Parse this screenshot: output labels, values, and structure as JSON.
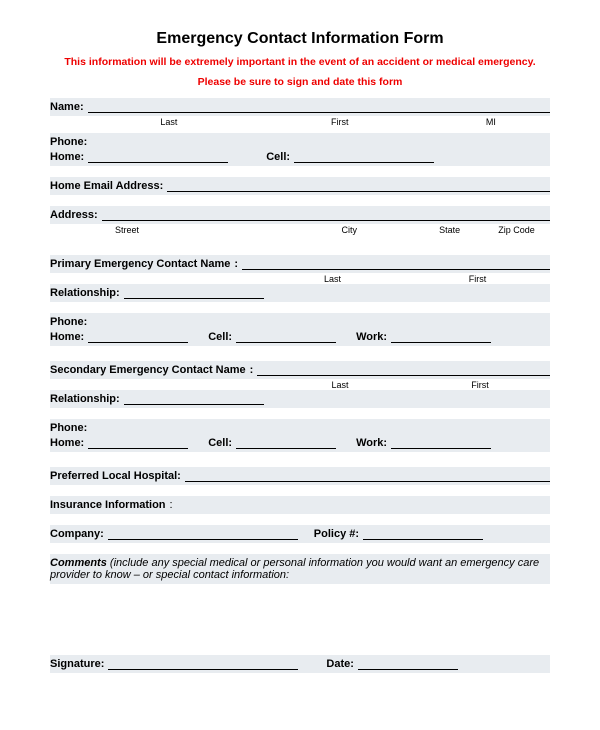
{
  "title": "Emergency Contact Information Form",
  "warning": "This information will be extremely important in the event of an accident or medical emergency.",
  "signprompt": "Please be sure to sign and date this form",
  "name_label": "Name:",
  "sub_last": "Last",
  "sub_first": "First",
  "sub_mi": "MI",
  "phone_label": "Phone:",
  "home_label": "Home:",
  "cell_label": "Cell:",
  "email_label": "Home Email Address:",
  "address_label": "Address:",
  "sub_street": "Street",
  "sub_city": "City",
  "sub_state": "State",
  "sub_zip": "Zip Code",
  "primary_label": "Primary Emergency Contact Name",
  "secondary_label": "Secondary Emergency Contact Name",
  "relationship_label": "Relationship:",
  "work_label": "Work:",
  "hospital_label": "Preferred Local Hospital:",
  "insurance_label": "Insurance Information",
  "company_label": "Company:",
  "policy_label": "Policy #:",
  "comments_label": "Comments",
  "comments_text": " (include any special medical or personal information you would want an emergency care provider to know – or special contact information:",
  "signature_label": "Signature:",
  "date_label": "Date:"
}
